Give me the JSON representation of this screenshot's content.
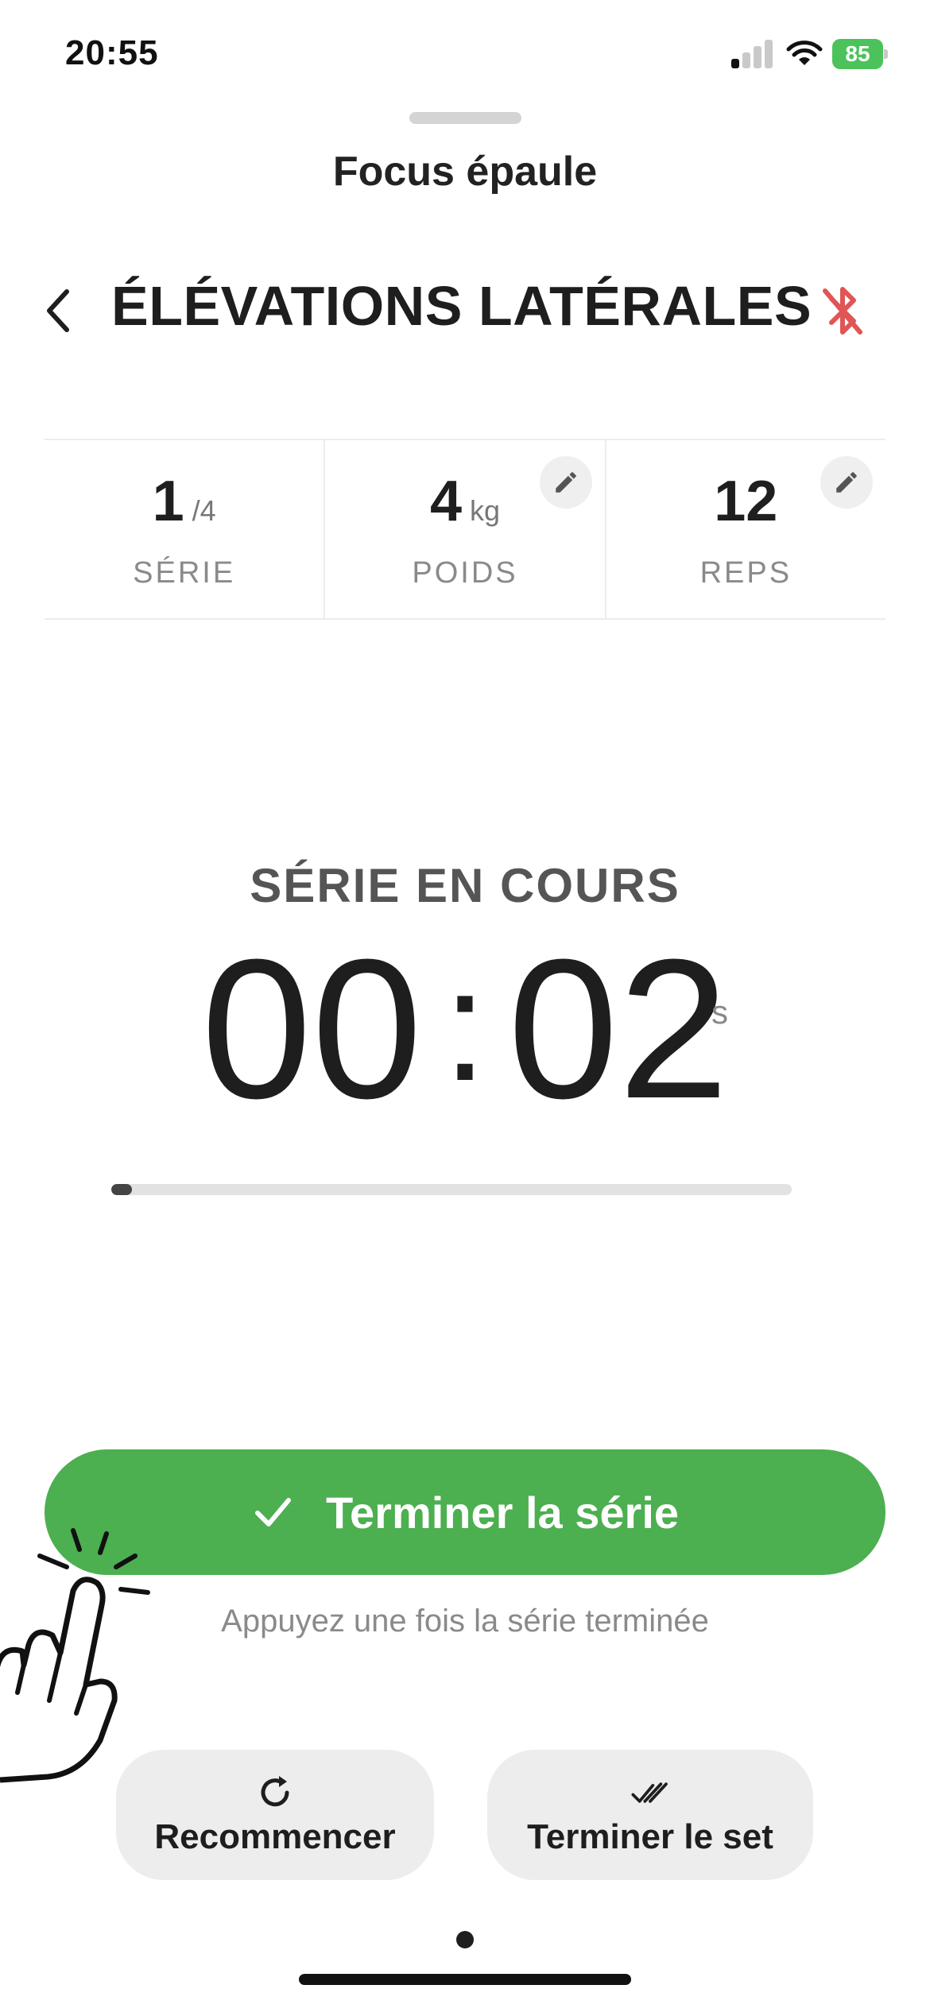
{
  "status_bar": {
    "time": "20:55",
    "battery": "85"
  },
  "sheet": {
    "title": "Focus épaule"
  },
  "exercise": {
    "title": "ÉLÉVATIONS LATÉRALES"
  },
  "stats": [
    {
      "value": "1",
      "unit": "/4",
      "label": "SÉRIE",
      "editable": false
    },
    {
      "value": "4",
      "unit": "kg",
      "label": "POIDS",
      "editable": true
    },
    {
      "value": "12",
      "unit": "",
      "label": "REPS",
      "editable": true
    }
  ],
  "timer": {
    "status": "SÉRIE EN COURS",
    "minutes": "00",
    "separator": ":",
    "seconds": "02",
    "unit": "s",
    "progress_fraction": 0.03
  },
  "primary_button": {
    "label": "Terminer la série",
    "color": "#4caf50"
  },
  "hint": "Appuyez une fois la série terminée",
  "secondary_buttons": {
    "restart": "Recommencer",
    "end_set": "Terminer le set"
  },
  "colors": {
    "accent_green": "#4caf50",
    "bluetooth_off": "#e05555"
  },
  "icons": [
    "back-chevron-icon",
    "bluetooth-off-icon",
    "pencil-icon",
    "check-icon",
    "refresh-icon",
    "double-check-icon",
    "tap-hand-icon"
  ]
}
